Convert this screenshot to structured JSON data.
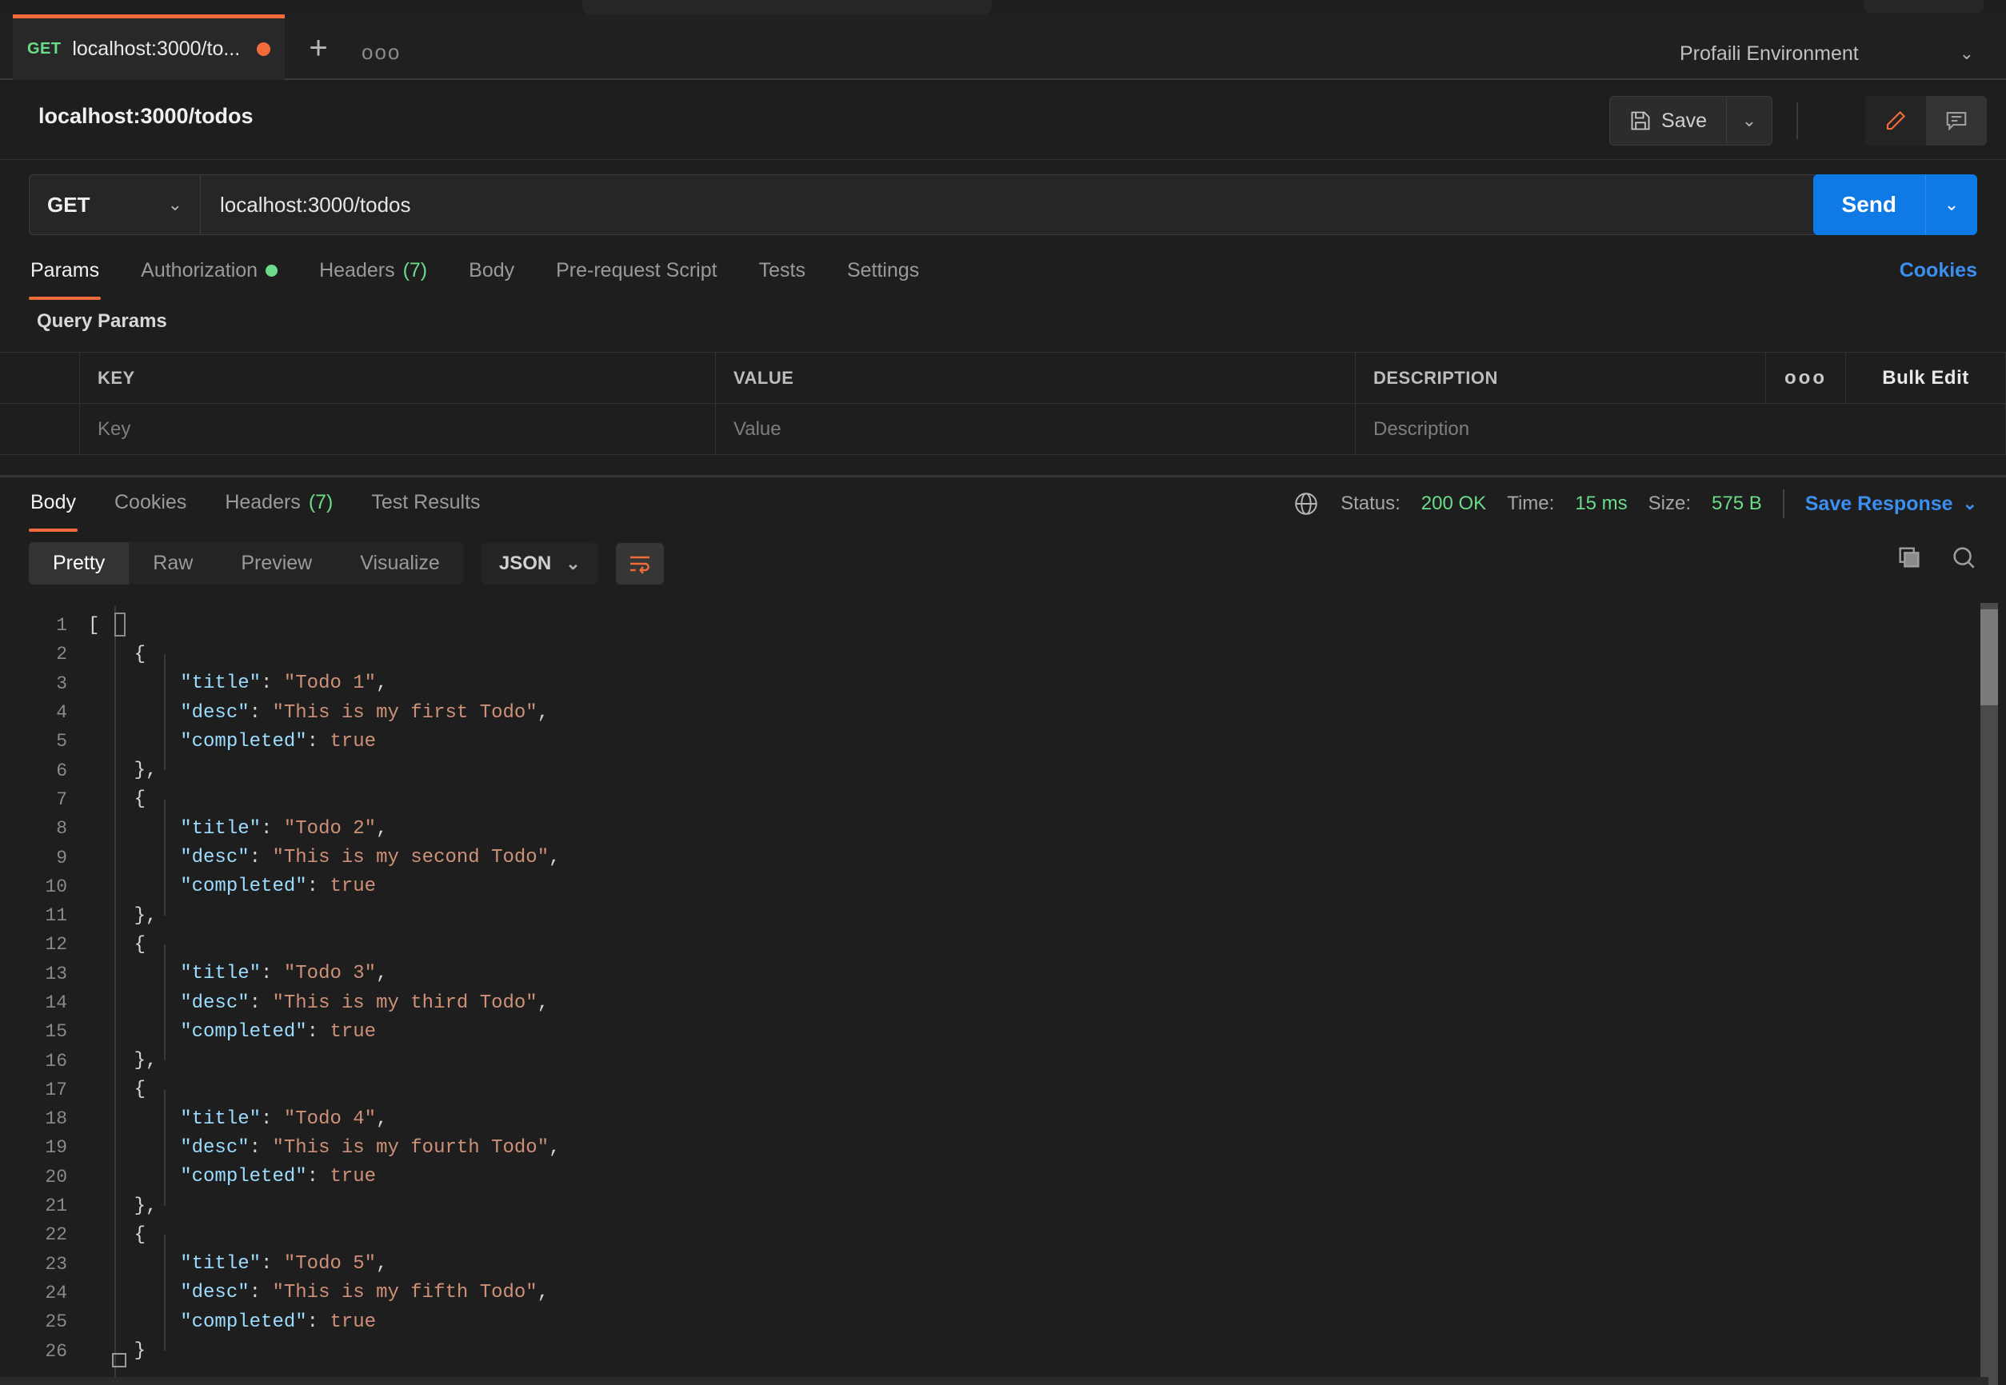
{
  "tab_bar": {
    "request_tab": {
      "method": "GET",
      "title": "localhost:3000/to...",
      "unsaved": true
    },
    "new_tab_label": "+",
    "more_label": "ooo",
    "environment": {
      "name": "Profaili Environment",
      "caret": "⌄"
    }
  },
  "request_header": {
    "breadcrumb": "localhost:3000/todos",
    "save_label": "Save",
    "save_caret": "⌄"
  },
  "url_bar": {
    "method": "GET",
    "method_caret": "⌄",
    "url": "localhost:3000/todos",
    "send_label": "Send",
    "send_caret": "⌄"
  },
  "request_tabs": {
    "items": [
      {
        "label": "Params",
        "active": true
      },
      {
        "label": "Authorization",
        "dot": true
      },
      {
        "label": "Headers",
        "count": "(7)"
      },
      {
        "label": "Body"
      },
      {
        "label": "Pre-request Script"
      },
      {
        "label": "Tests"
      },
      {
        "label": "Settings"
      }
    ],
    "cookies_link": "Cookies"
  },
  "query_params": {
    "section_title": "Query Params",
    "columns": [
      "KEY",
      "VALUE",
      "DESCRIPTION"
    ],
    "more_label": "ooo",
    "bulk_edit_label": "Bulk Edit",
    "placeholder_row": {
      "key": "Key",
      "value": "Value",
      "description": "Description"
    }
  },
  "response": {
    "tabs": [
      {
        "label": "Body",
        "active": true
      },
      {
        "label": "Cookies"
      },
      {
        "label": "Headers",
        "count": "(7)"
      },
      {
        "label": "Test Results"
      }
    ],
    "status_label": "Status:",
    "status_value": "200 OK",
    "time_label": "Time:",
    "time_value": "15 ms",
    "size_label": "Size:",
    "size_value": "575 B",
    "save_response_label": "Save Response",
    "save_response_caret": "⌄",
    "format_tabs": [
      {
        "label": "Pretty",
        "active": true
      },
      {
        "label": "Raw"
      },
      {
        "label": "Preview"
      },
      {
        "label": "Visualize"
      }
    ],
    "language": "JSON",
    "language_caret": "⌄"
  },
  "colors": {
    "accent_orange": "#f26b3a",
    "send_blue": "#0f7ae5",
    "link_blue": "#3b8ff0",
    "success_green": "#6bdc8a",
    "json_key": "#9cdcfe",
    "json_string": "#ce9178",
    "background": "#1e1e1e"
  },
  "code_view": {
    "lines": [
      {
        "n": 1,
        "indent": 0,
        "html": "["
      },
      {
        "n": 2,
        "indent": 1,
        "html": "{"
      },
      {
        "n": 3,
        "indent": 2,
        "key": "\"title\"",
        "sep": ": ",
        "val": "\"Todo 1\"",
        "tail": ","
      },
      {
        "n": 4,
        "indent": 2,
        "key": "\"desc\"",
        "sep": ": ",
        "val": "\"This is my first Todo\"",
        "tail": ","
      },
      {
        "n": 5,
        "indent": 2,
        "key": "\"completed\"",
        "sep": ": ",
        "val": "true",
        "tail": ""
      },
      {
        "n": 6,
        "indent": 1,
        "html": "},"
      },
      {
        "n": 7,
        "indent": 1,
        "html": "{"
      },
      {
        "n": 8,
        "indent": 2,
        "key": "\"title\"",
        "sep": ": ",
        "val": "\"Todo 2\"",
        "tail": ","
      },
      {
        "n": 9,
        "indent": 2,
        "key": "\"desc\"",
        "sep": ": ",
        "val": "\"This is my second Todo\"",
        "tail": ","
      },
      {
        "n": 10,
        "indent": 2,
        "key": "\"completed\"",
        "sep": ": ",
        "val": "true",
        "tail": ""
      },
      {
        "n": 11,
        "indent": 1,
        "html": "},"
      },
      {
        "n": 12,
        "indent": 1,
        "html": "{"
      },
      {
        "n": 13,
        "indent": 2,
        "key": "\"title\"",
        "sep": ": ",
        "val": "\"Todo 3\"",
        "tail": ","
      },
      {
        "n": 14,
        "indent": 2,
        "key": "\"desc\"",
        "sep": ": ",
        "val": "\"This is my third Todo\"",
        "tail": ","
      },
      {
        "n": 15,
        "indent": 2,
        "key": "\"completed\"",
        "sep": ": ",
        "val": "true",
        "tail": ""
      },
      {
        "n": 16,
        "indent": 1,
        "html": "},"
      },
      {
        "n": 17,
        "indent": 1,
        "html": "{"
      },
      {
        "n": 18,
        "indent": 2,
        "key": "\"title\"",
        "sep": ": ",
        "val": "\"Todo 4\"",
        "tail": ","
      },
      {
        "n": 19,
        "indent": 2,
        "key": "\"desc\"",
        "sep": ": ",
        "val": "\"This is my fourth Todo\"",
        "tail": ","
      },
      {
        "n": 20,
        "indent": 2,
        "key": "\"completed\"",
        "sep": ": ",
        "val": "true",
        "tail": ""
      },
      {
        "n": 21,
        "indent": 1,
        "html": "},"
      },
      {
        "n": 22,
        "indent": 1,
        "html": "{"
      },
      {
        "n": 23,
        "indent": 2,
        "key": "\"title\"",
        "sep": ": ",
        "val": "\"Todo 5\"",
        "tail": ","
      },
      {
        "n": 24,
        "indent": 2,
        "key": "\"desc\"",
        "sep": ": ",
        "val": "\"This is my fifth Todo\"",
        "tail": ","
      },
      {
        "n": 25,
        "indent": 2,
        "key": "\"completed\"",
        "sep": ": ",
        "val": "true",
        "tail": ""
      },
      {
        "n": 26,
        "indent": 1,
        "html": "}"
      }
    ]
  }
}
